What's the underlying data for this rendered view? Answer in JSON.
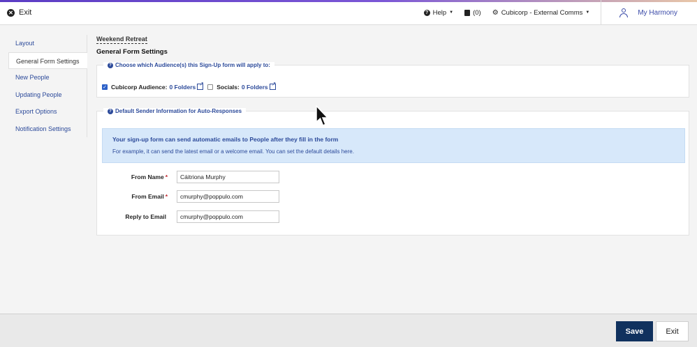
{
  "topbar": {
    "exit_label": "Exit",
    "help_label": "Help",
    "notes_count": "(0)",
    "org_label": "Cubicorp - External Comms",
    "my_harmony_label": "My Harmony"
  },
  "sidebar": {
    "items": [
      {
        "label": "Layout"
      },
      {
        "label": "General Form Settings"
      },
      {
        "label": "New People"
      },
      {
        "label": "Updating People"
      },
      {
        "label": "Export Options"
      },
      {
        "label": "Notification Settings"
      }
    ],
    "active": "General Form Settings"
  },
  "main": {
    "breadcrumb": "Weekend Retreat",
    "title": "General Form Settings",
    "audience": {
      "legend": "Choose which Audience(s) this Sign-Up form will apply to:",
      "options": [
        {
          "label": "Cubicorp Audience:",
          "link": "0 Folders",
          "checked": true
        },
        {
          "label": "Socials:",
          "link": "0 Folders",
          "checked": false
        }
      ]
    },
    "sender": {
      "legend": "Default Sender Information for Auto-Responses",
      "info_title": "Your sign-up form can send automatic emails to People after they fill in the form",
      "info_text": "For example, it can send the latest email or a welcome email. You can set the default details here.",
      "fields": [
        {
          "label": "From Name",
          "required": "*",
          "value": "Cáitriona Murphy"
        },
        {
          "label": "From Email",
          "required": "*",
          "value": "cmurphy@poppulo.com"
        },
        {
          "label": "Reply to Email",
          "required": "",
          "value": "cmurphy@poppulo.com"
        }
      ]
    }
  },
  "footer": {
    "save_label": "Save",
    "exit_label": "Exit"
  },
  "colors": {
    "primary": "#10315e",
    "link": "#2c4a9a",
    "info_bg": "#d7e8fa",
    "required": "#c0262d"
  }
}
